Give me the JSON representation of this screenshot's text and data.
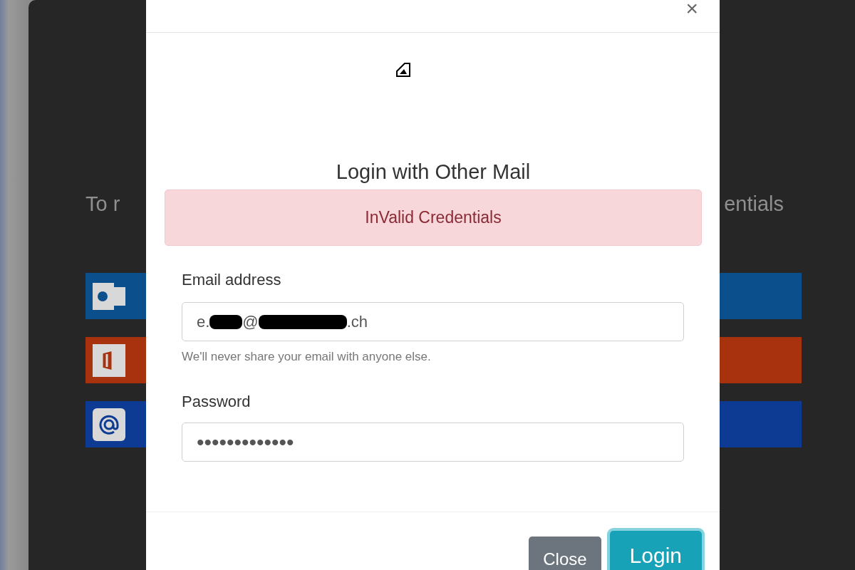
{
  "background": {
    "text_left": "To r",
    "text_right": "entials",
    "services": [
      {
        "kind": "outlook",
        "color": "#0b4f8c"
      },
      {
        "kind": "office",
        "color": "#a8320d"
      },
      {
        "kind": "mail",
        "color": "#0d3a93"
      }
    ]
  },
  "modal": {
    "close_symbol": "×",
    "title": "Login with Other Mail",
    "alert": "InValid Credentials",
    "email": {
      "label": "Email address",
      "value_parts": [
        {
          "kind": "text",
          "text": "e."
        },
        {
          "kind": "redacted"
        },
        {
          "kind": "text",
          "text": "@"
        },
        {
          "kind": "redacted"
        },
        {
          "kind": "text",
          "text": ".ch"
        }
      ],
      "help": "We'll never share your email with anyone else."
    },
    "password": {
      "label": "Password",
      "value": "•••••••••••••"
    },
    "buttons": [
      {
        "kind": "secondary",
        "label": "Close",
        "focused": false
      },
      {
        "kind": "primary",
        "label": "Login",
        "focused": true
      }
    ]
  }
}
